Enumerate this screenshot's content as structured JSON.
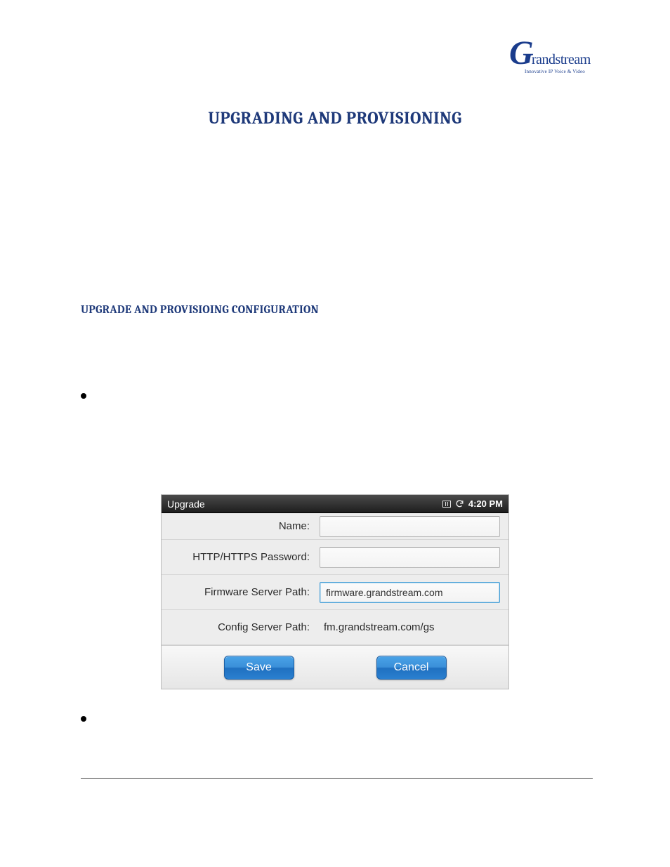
{
  "logo": {
    "brand_g": "G",
    "brand_rest": "randstream",
    "tagline": "Innovative IP Voice & Video"
  },
  "page": {
    "title": "UPGRADING AND PROVISIONING",
    "section_title": "UPGRADE AND PROVISIOING CONFIGURATION"
  },
  "panel": {
    "title": "Upgrade",
    "time": "4:20 PM",
    "rows": {
      "name_label": "Name:",
      "name_value": "",
      "password_label": "HTTP/HTTPS Password:",
      "password_value": "",
      "firmware_label": "Firmware Server Path:",
      "firmware_value": "firmware.grandstream.com",
      "config_label": "Config Server Path:",
      "config_value": "fm.grandstream.com/gs"
    },
    "buttons": {
      "save": "Save",
      "cancel": "Cancel"
    }
  }
}
